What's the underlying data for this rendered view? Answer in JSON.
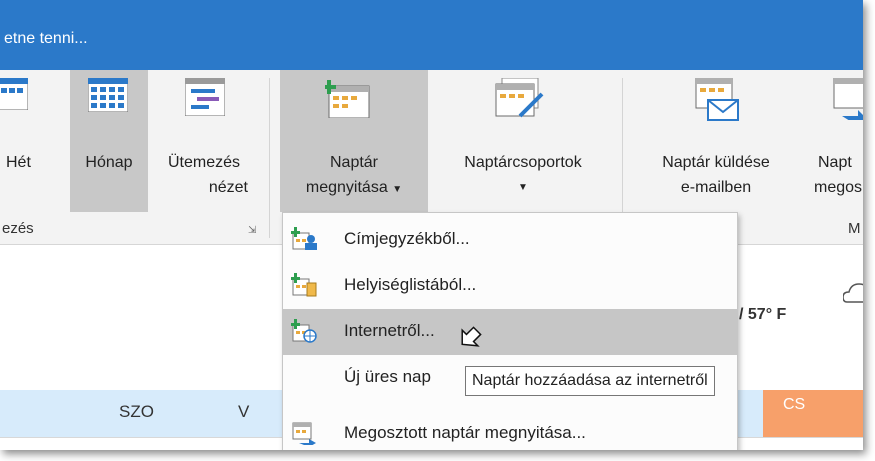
{
  "titlebar": {
    "search_text": "etne tenni..."
  },
  "ribbon": {
    "buttons": [
      {
        "label": "Hét"
      },
      {
        "label": "Hónap"
      },
      {
        "label": "Ütemezés",
        "label2": "nézet"
      },
      {
        "label": "Naptár",
        "label2": "megnyitása"
      },
      {
        "label": "Naptárcsoportok"
      },
      {
        "label": "Naptár küldése",
        "label2": "e-mailben"
      },
      {
        "label": "Napt",
        "label2": "megos"
      }
    ],
    "groups": [
      {
        "label": "ezés"
      },
      {
        "label": "M"
      }
    ]
  },
  "menu": {
    "items": [
      {
        "label": "Címjegyzékből..."
      },
      {
        "label": "Helyiséglistából..."
      },
      {
        "label": "Internetről..."
      },
      {
        "label": "Új üres nap"
      },
      {
        "label": "Megosztott naptár megnyitása..."
      }
    ]
  },
  "tooltip": {
    "text": "Naptár hozzáadása az internetről"
  },
  "weather": {
    "temp": "/ 57° F"
  },
  "calendar": {
    "days": [
      "SZO",
      "V",
      "CS"
    ]
  },
  "colors": {
    "titlebar": "#2b79c9",
    "accent_orange": "#f7a06a",
    "day_bar": "#d7ebfb"
  }
}
